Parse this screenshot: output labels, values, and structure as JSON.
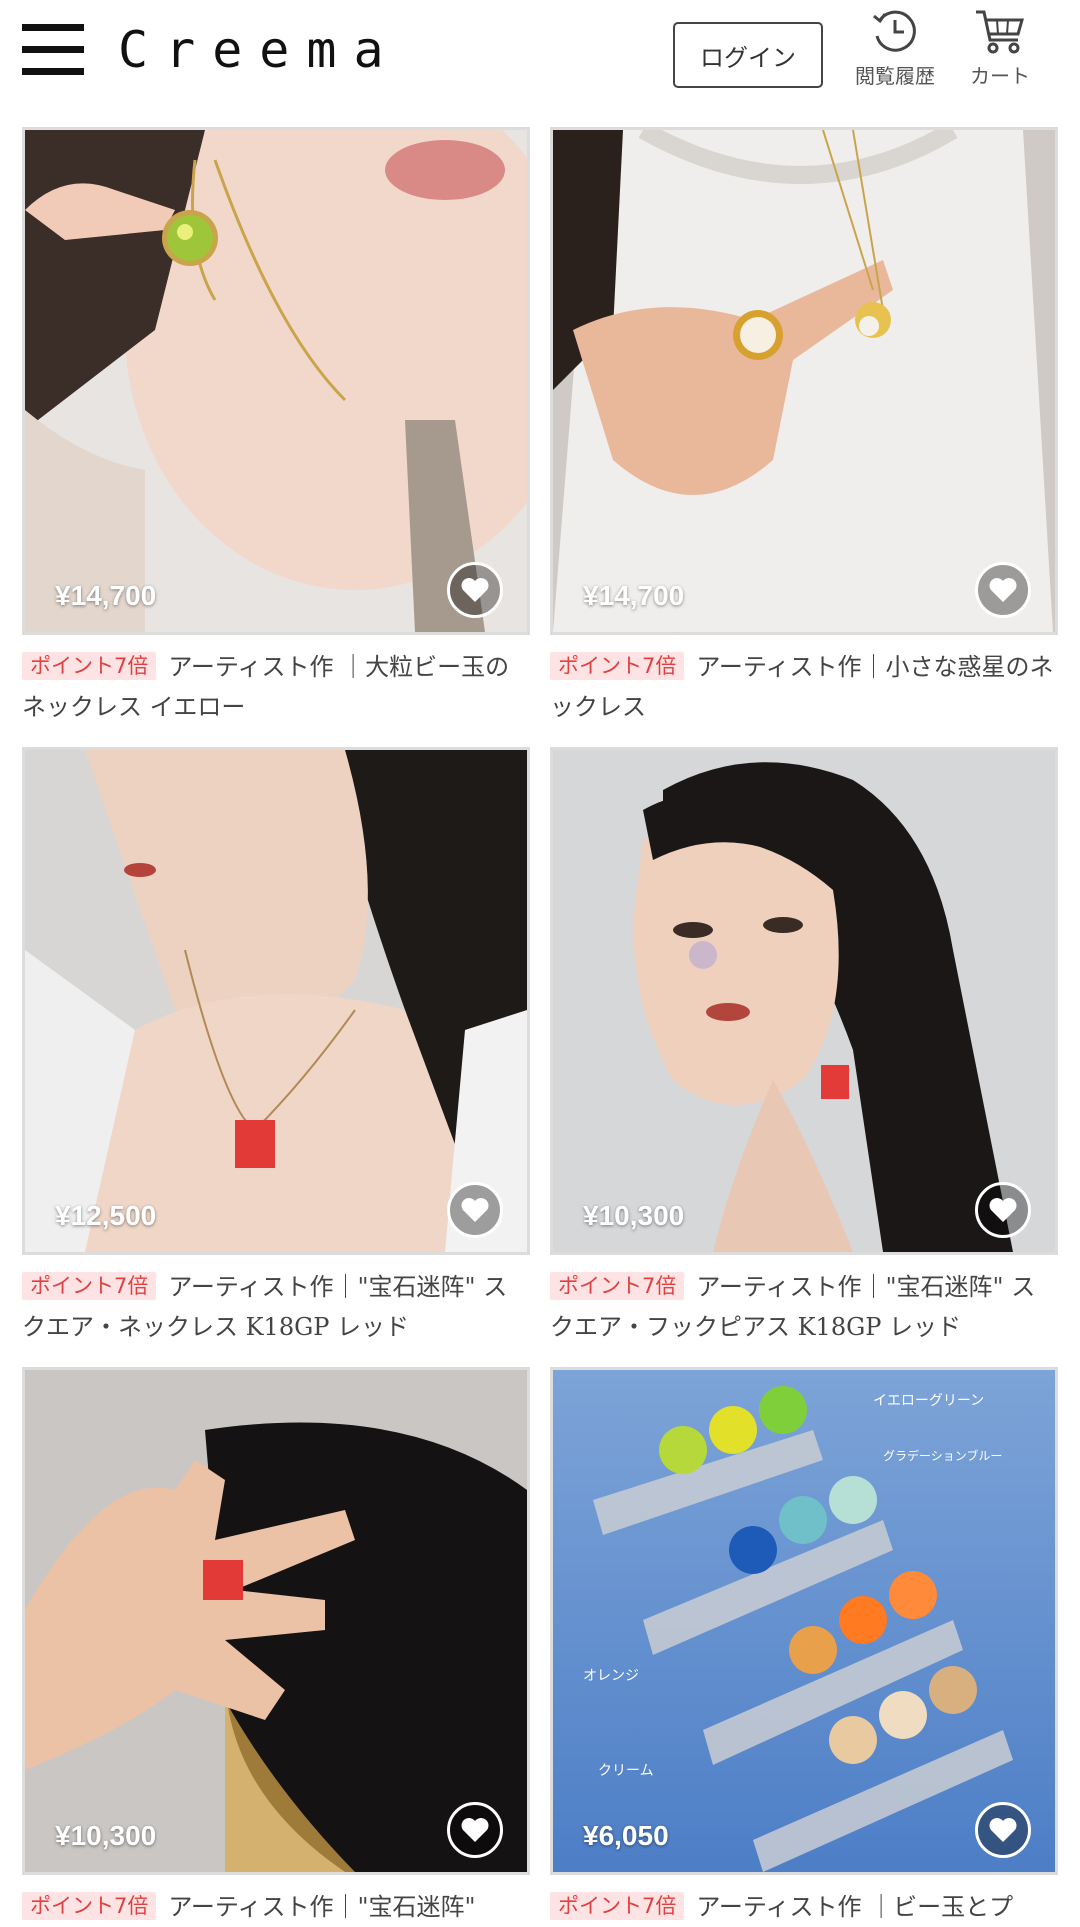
{
  "header": {
    "logo": "Creema",
    "login_label": "ログイン",
    "history_label": "閲覧履歴",
    "cart_label": "カート",
    "menu_icon": "hamburger-menu-icon",
    "history_icon": "clock-history-icon",
    "cart_icon": "shopping-cart-icon"
  },
  "products": [
    {
      "price": "¥14,700",
      "badge": "ポイント7倍",
      "title": "アーティスト作 ｜大粒ビー玉のネックレス イエロー"
    },
    {
      "price": "¥14,700",
      "badge": "ポイント7倍",
      "title": "アーティスト作｜小さな惑星のネックレス"
    },
    {
      "price": "¥12,500",
      "badge": "ポイント7倍",
      "title": "アーティスト作｜\"宝石迷阵\" スクエア・ネックレス K18GP レッド"
    },
    {
      "price": "¥10,300",
      "badge": "ポイント7倍",
      "title": "アーティスト作｜\"宝石迷阵\" スクエア・フックピアス K18GP レッド"
    },
    {
      "price": "¥10,300",
      "badge": "ポイント7倍",
      "title": "アーティスト作｜\"宝石迷阵\""
    },
    {
      "price": "¥6,050",
      "badge": "ポイント7倍",
      "title": "アーティスト作 ｜ビー玉とプ"
    }
  ],
  "photo_annotations": {
    "yellow_green": "イエローグリーン",
    "gradation_blue": "グラデーションブルー",
    "orange": "オレンジ",
    "cream": "クリーム"
  },
  "colors": {
    "badge_bg": "#fde3e3",
    "badge_text": "#e04040",
    "card_border": "#dcdcdc"
  }
}
